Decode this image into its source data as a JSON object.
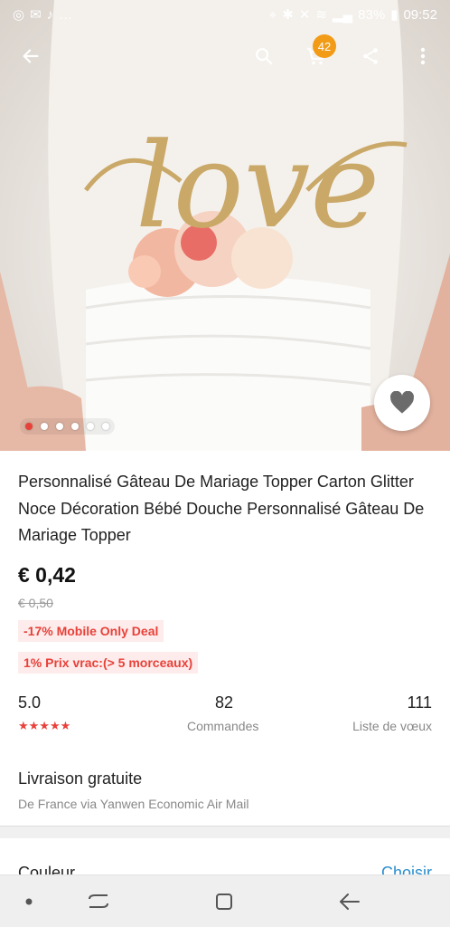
{
  "status": {
    "battery": "83%",
    "time": "09:52"
  },
  "cart_count": "42",
  "product": {
    "title": "Personnalisé Gâteau De Mariage Topper Carton Glitter Noce Décoration Bébé Douche Personnalisé Gâteau De Mariage Topper",
    "price": "€ 0,42",
    "old_price": "€ 0,50",
    "deal_tag": "-17% Mobile Only Deal",
    "bulk_tag": "1% Prix vrac:(> 5 morceaux)",
    "image_text": "love"
  },
  "stats": {
    "rating": "5.0",
    "stars": "★★★★★",
    "orders": "82",
    "orders_label": "Commandes",
    "wishlist": "111",
    "wishlist_label": "Liste de vœux"
  },
  "shipping": {
    "title": "Livraison gratuite",
    "subtitle": "De France via Yanwen Economic Air Mail"
  },
  "color": {
    "label": "Couleur",
    "action": "Choisir"
  },
  "carousel": {
    "count": 6,
    "active": 0
  },
  "icons": {
    "back": "arrow-left-icon",
    "search": "search-icon",
    "cart": "cart-icon",
    "share": "share-icon",
    "more": "more-vertical-icon",
    "favorite": "heart-icon"
  }
}
